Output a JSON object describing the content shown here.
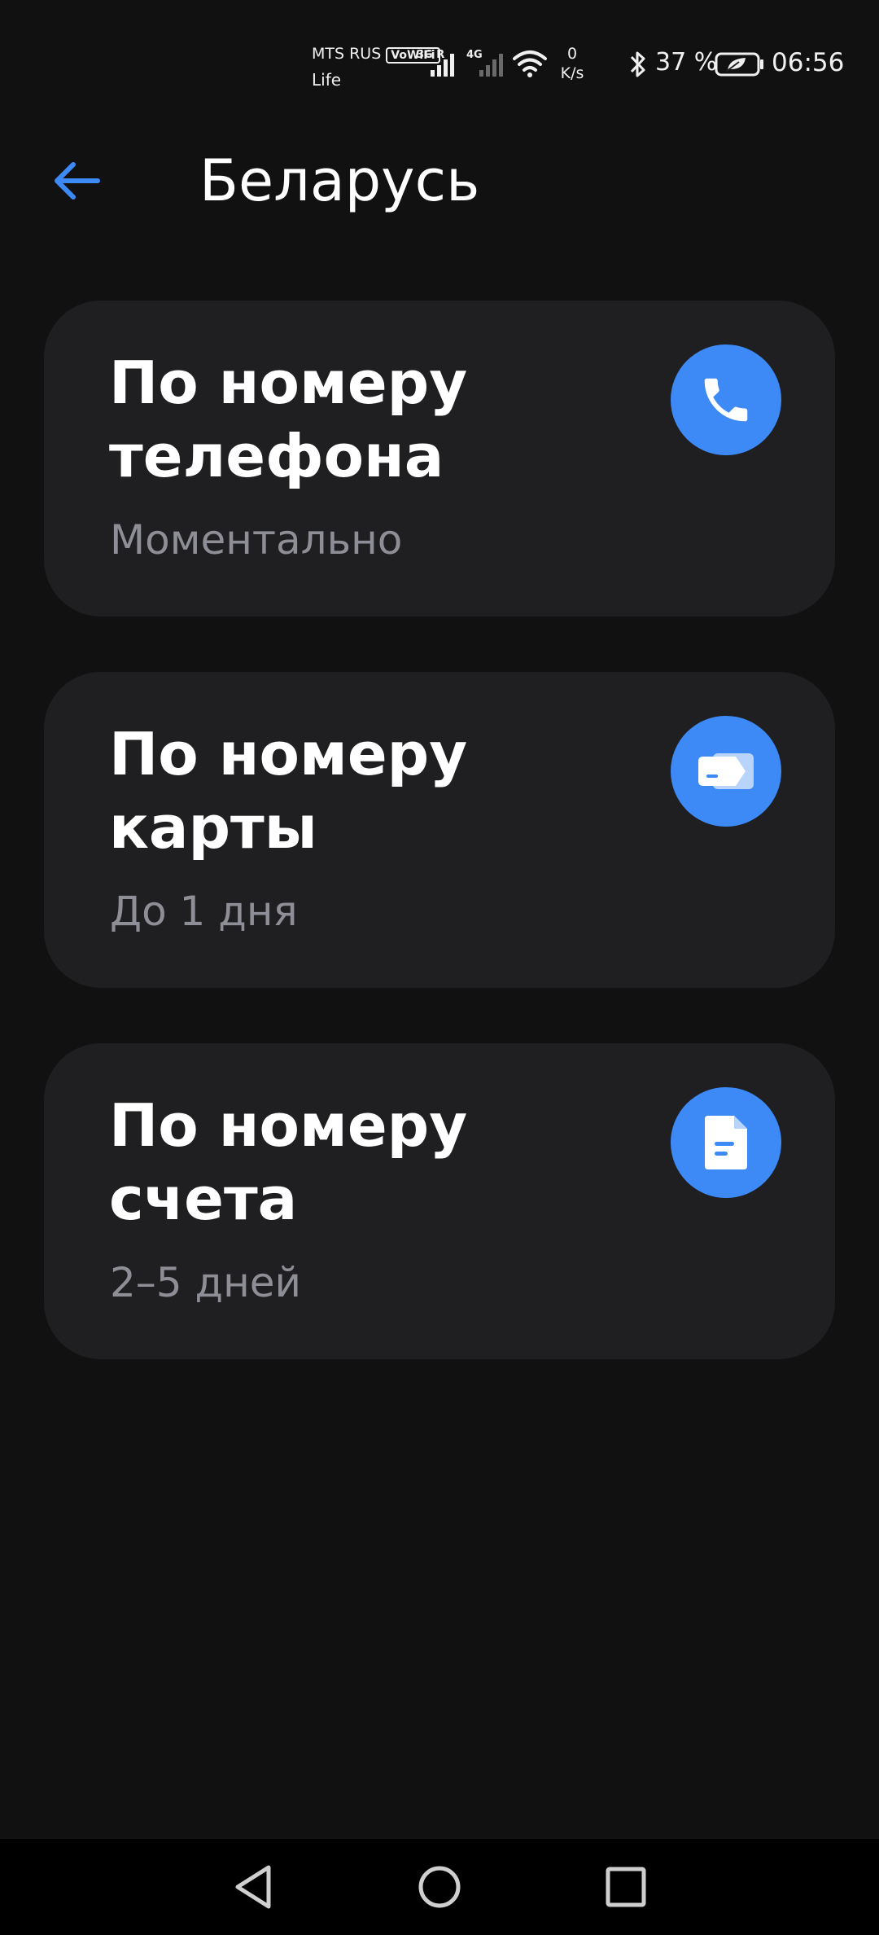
{
  "status_bar": {
    "carrier_line1": "MTS RUS",
    "vowifi_badge": "VoWiFi",
    "carrier_line2": "Life",
    "net1_label": "3G R",
    "net2_label": "4G",
    "speed_value": "0",
    "speed_unit": "K/s",
    "battery_percent": "37 %",
    "time": "06:56"
  },
  "header": {
    "title": "Беларусь"
  },
  "options": [
    {
      "title_line1": "По номеру",
      "title_line2": "телефона",
      "subtitle": "Моментально",
      "icon": "phone-icon"
    },
    {
      "title_line1": "По номеру",
      "title_line2": "карты",
      "subtitle": "До 1 дня",
      "icon": "card-icon"
    },
    {
      "title_line1": "По номеру",
      "title_line2": "счета",
      "subtitle": "2–5 дней",
      "icon": "document-icon"
    }
  ],
  "colors": {
    "background": "#111112",
    "card": "#1f1f22",
    "accent": "#3d8af7",
    "subtitle": "#8e8e96"
  }
}
